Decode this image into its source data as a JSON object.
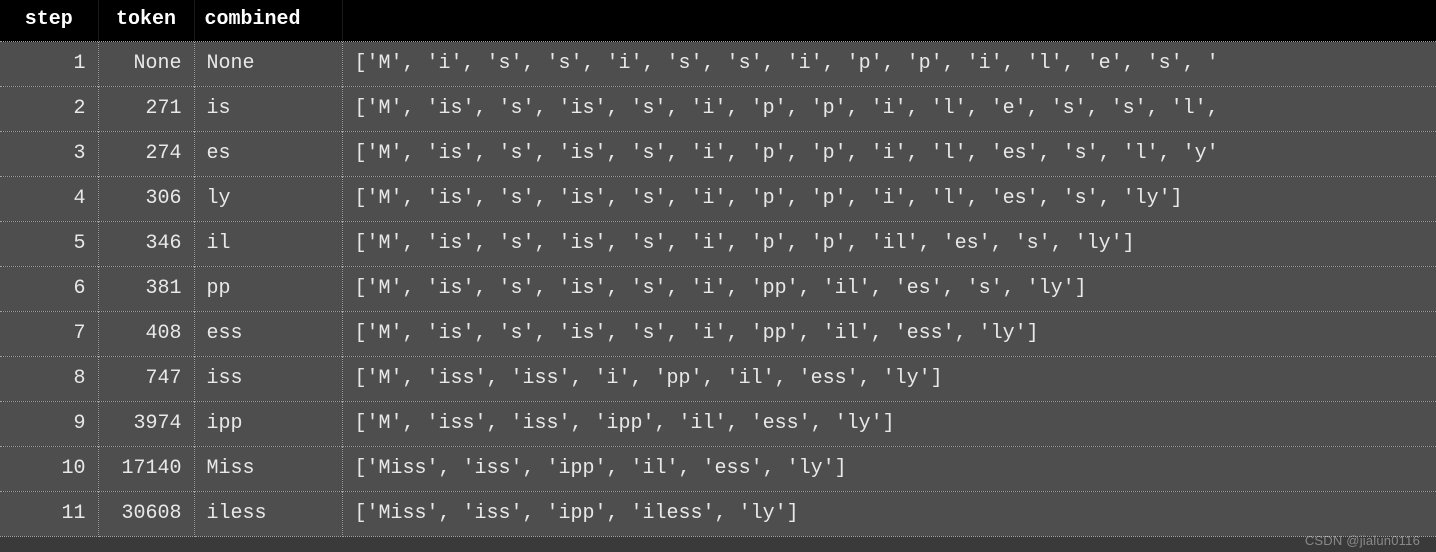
{
  "headers": {
    "step": "step",
    "token": "token",
    "combined": "combined",
    "list": ""
  },
  "rows": [
    {
      "step": "1",
      "token": "None",
      "combined": "None",
      "list": "['M', 'i', 's', 's', 'i', 's', 's', 'i', 'p', 'p', 'i', 'l', 'e', 's', '"
    },
    {
      "step": "2",
      "token": "271",
      "combined": "is",
      "list": "['M', 'is', 's', 'is', 's', 'i', 'p', 'p', 'i', 'l', 'e', 's', 's', 'l',"
    },
    {
      "step": "3",
      "token": "274",
      "combined": "es",
      "list": "['M', 'is', 's', 'is', 's', 'i', 'p', 'p', 'i', 'l', 'es', 's', 'l', 'y'"
    },
    {
      "step": "4",
      "token": "306",
      "combined": "ly",
      "list": "['M', 'is', 's', 'is', 's', 'i', 'p', 'p', 'i', 'l', 'es', 's', 'ly']"
    },
    {
      "step": "5",
      "token": "346",
      "combined": "il",
      "list": "['M', 'is', 's', 'is', 's', 'i', 'p', 'p', 'il', 'es', 's', 'ly']"
    },
    {
      "step": "6",
      "token": "381",
      "combined": "pp",
      "list": "['M', 'is', 's', 'is', 's', 'i', 'pp', 'il', 'es', 's', 'ly']"
    },
    {
      "step": "7",
      "token": "408",
      "combined": "ess",
      "list": "['M', 'is', 's', 'is', 's', 'i', 'pp', 'il', 'ess', 'ly']"
    },
    {
      "step": "8",
      "token": "747",
      "combined": "iss",
      "list": "['M', 'iss', 'iss', 'i', 'pp', 'il', 'ess', 'ly']"
    },
    {
      "step": "9",
      "token": "3974",
      "combined": "ipp",
      "list": "['M', 'iss', 'iss', 'ipp', 'il', 'ess', 'ly']"
    },
    {
      "step": "10",
      "token": "17140",
      "combined": "Miss",
      "list": "['Miss', 'iss', 'ipp', 'il', 'ess', 'ly']"
    },
    {
      "step": "11",
      "token": "30608",
      "combined": "iless",
      "list": "['Miss', 'iss', 'ipp', 'iless', 'ly']"
    }
  ],
  "watermark": "CSDN @jialun0116"
}
